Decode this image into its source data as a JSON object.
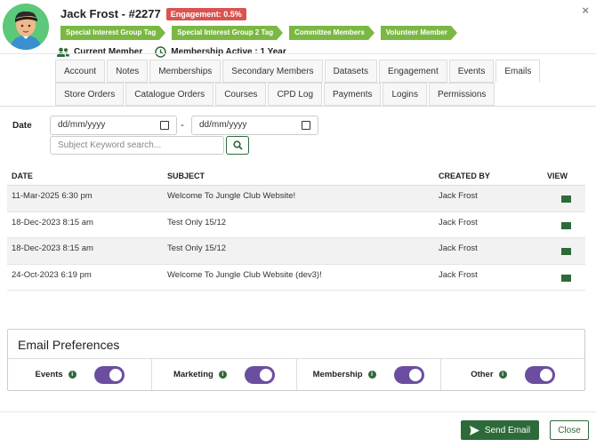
{
  "member": {
    "name": "Jack Frost - #2277",
    "engagement": "Engagement: 0.5%",
    "tags": [
      "Special Interest Group Tag",
      "Special Interest Group 2 Tag",
      "Committee Members",
      "Volunteer Member"
    ],
    "current": "Current Member",
    "membership": "Membership Active : 1 Year"
  },
  "tabs": {
    "row1": [
      "Account",
      "Notes",
      "Memberships",
      "Secondary Members",
      "Datasets",
      "Engagement",
      "Events",
      "Emails"
    ],
    "row2": [
      "Store Orders",
      "Catalogue Orders",
      "Courses",
      "CPD Log",
      "Payments",
      "Logins",
      "Permissions"
    ],
    "active": "Emails"
  },
  "filters": {
    "date_label": "Date",
    "date_from": "dd/mm/yyyy",
    "separator": "-",
    "date_to": "dd/mm/yyyy",
    "keyword_placeholder": "Subject Keyword search..."
  },
  "table": {
    "headers": [
      "DATE",
      "SUBJECT",
      "CREATED BY",
      "VIEW"
    ],
    "rows": [
      {
        "date": "11-Mar-2025 6:30 pm",
        "subject": "Welcome To Jungle Club Website!",
        "created_by": "Jack Frost"
      },
      {
        "date": "18-Dec-2023 8:15 am",
        "subject": "Test Only 15/12",
        "created_by": "Jack Frost"
      },
      {
        "date": "18-Dec-2023 8:15 am",
        "subject": "Test Only 15/12",
        "created_by": "Jack Frost"
      },
      {
        "date": "24-Oct-2023 6:19 pm",
        "subject": "Welcome To Jungle Club Website (dev3)!",
        "created_by": "Jack Frost"
      }
    ]
  },
  "preferences": {
    "title": "Email Preferences",
    "items": [
      {
        "label": "Events",
        "enabled": true
      },
      {
        "label": "Marketing",
        "enabled": true
      },
      {
        "label": "Membership",
        "enabled": true
      },
      {
        "label": "Other",
        "enabled": true
      }
    ]
  },
  "footer": {
    "send_label": "Send Email",
    "close_label": "Close"
  },
  "colors": {
    "primary": "#2d6a3a",
    "tag": "#7ab843",
    "badge": "#d9534f",
    "toggle": "#6b4ea0"
  }
}
